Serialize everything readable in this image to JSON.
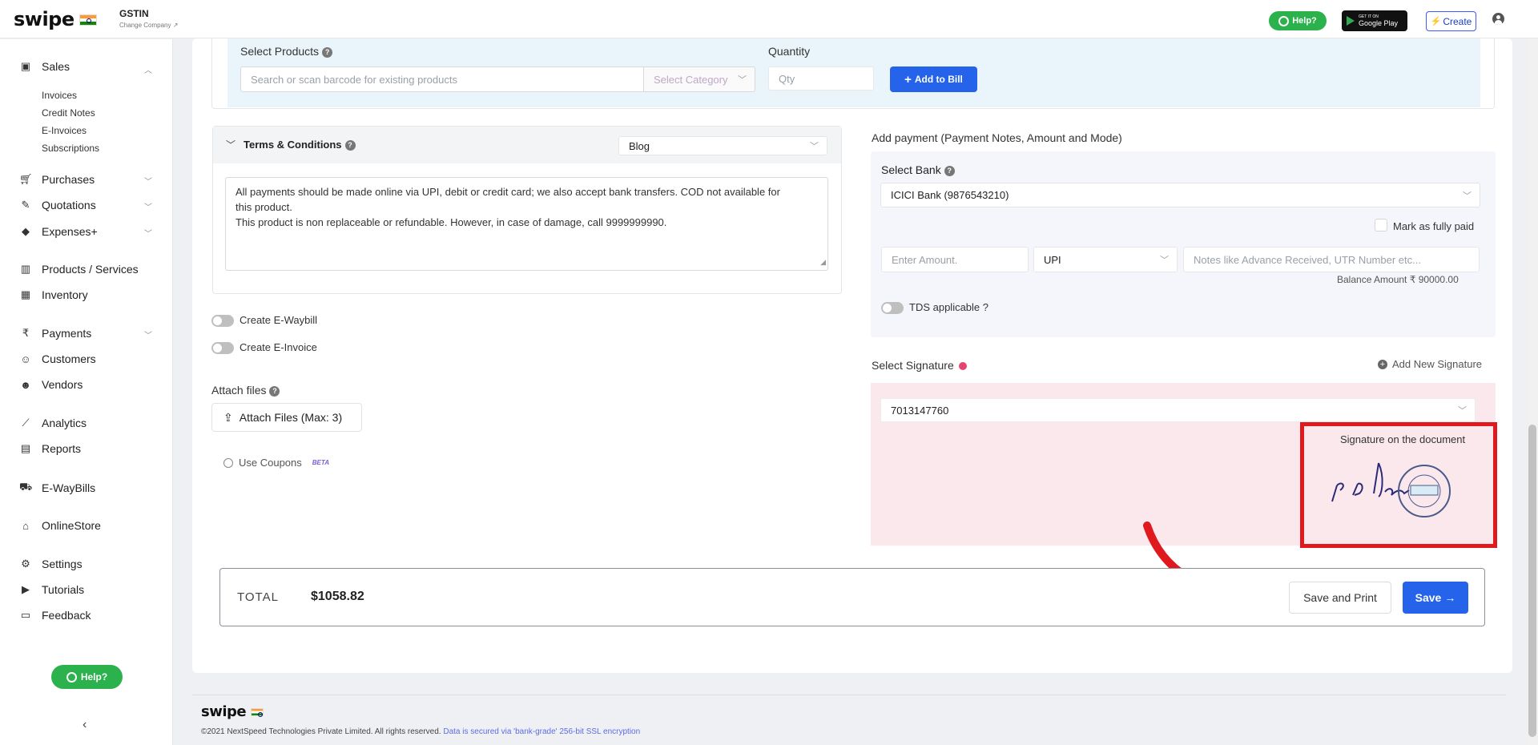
{
  "header": {
    "logo": "swipe",
    "gstin_label": "GSTIN",
    "change_company": "Change Company ↗",
    "help_label": "Help?",
    "google_play_small": "GET IT ON",
    "google_play_big": "Google Play",
    "create_label": "Create"
  },
  "sidebar": {
    "items": [
      {
        "label": "Sales",
        "icon": "sales-icon"
      },
      {
        "label": "Purchases",
        "icon": "cart-icon"
      },
      {
        "label": "Quotations",
        "icon": "pen-icon"
      },
      {
        "label": "Expenses+",
        "icon": "tag-icon"
      },
      {
        "label": "Products / Services",
        "icon": "barcode-icon"
      },
      {
        "label": "Inventory",
        "icon": "inventory-icon"
      },
      {
        "label": "Payments",
        "icon": "rupee-icon"
      },
      {
        "label": "Customers",
        "icon": "user-icon"
      },
      {
        "label": "Vendors",
        "icon": "users-icon"
      },
      {
        "label": "Analytics",
        "icon": "chart-icon"
      },
      {
        "label": "Reports",
        "icon": "report-icon"
      },
      {
        "label": "E-WayBills",
        "icon": "truck-icon"
      },
      {
        "label": "OnlineStore",
        "icon": "store-icon"
      },
      {
        "label": "Settings",
        "icon": "gear-icon"
      },
      {
        "label": "Tutorials",
        "icon": "youtube-icon"
      },
      {
        "label": "Feedback",
        "icon": "message-icon"
      }
    ],
    "sales_sub": [
      "Invoices",
      "Credit Notes",
      "E-Invoices",
      "Subscriptions"
    ],
    "help_label": "Help?",
    "collapse_glyph": "‹"
  },
  "products": {
    "title": "Select Products",
    "search_placeholder": "Search or scan barcode for existing products",
    "category_placeholder": "Select Category",
    "quantity_label": "Quantity",
    "qty_placeholder": "Qty",
    "add_button": "Add to Bill"
  },
  "terms": {
    "title": "Terms & Conditions",
    "dropdown_value": "Blog",
    "text_line1": "All payments should be made online via UPI, debit or credit card; we also accept bank transfers. COD not available for",
    "text_line2": "this product.",
    "text_line3": "This product is non replaceable or refundable. However, in case of damage, call 9999999990."
  },
  "toggles": {
    "ewaybill": "Create E-Waybill",
    "einvoice": "Create E-Invoice"
  },
  "attach": {
    "label": "Attach files",
    "button": "Attach Files (Max: 3)",
    "coupons": "Use Coupons",
    "beta": "BETA"
  },
  "payment": {
    "title": "Add payment (Payment Notes, Amount and Mode)",
    "bank_label": "Select Bank",
    "bank_value": "ICICI Bank (9876543210)",
    "mark_paid": "Mark as fully paid",
    "amount_placeholder": "Enter Amount.",
    "mode_value": "UPI",
    "notes_placeholder": "Notes like Advance Received, UTR Number etc...",
    "balance": "Balance Amount ₹ 90000.00",
    "tds": "TDS applicable ?"
  },
  "signature": {
    "title": "Select Signature",
    "add_new": "Add New Signature",
    "value": "7013147760",
    "on_document": "Signature on the document"
  },
  "total": {
    "label": "TOTAL",
    "amount": "$1058.82",
    "save_print": "Save and Print",
    "save": "Save"
  },
  "footer": {
    "logo": "swipe",
    "copyright": "©2021 NextSpeed Technologies Private Limited. All rights reserved.",
    "security": "Data is secured via 'bank-grade' 256-bit SSL encryption"
  },
  "colors": {
    "accent": "#2563eb",
    "help_green": "#2bb24c",
    "highlight_red": "#e0191f",
    "signature_bg": "#fbe8ec"
  }
}
